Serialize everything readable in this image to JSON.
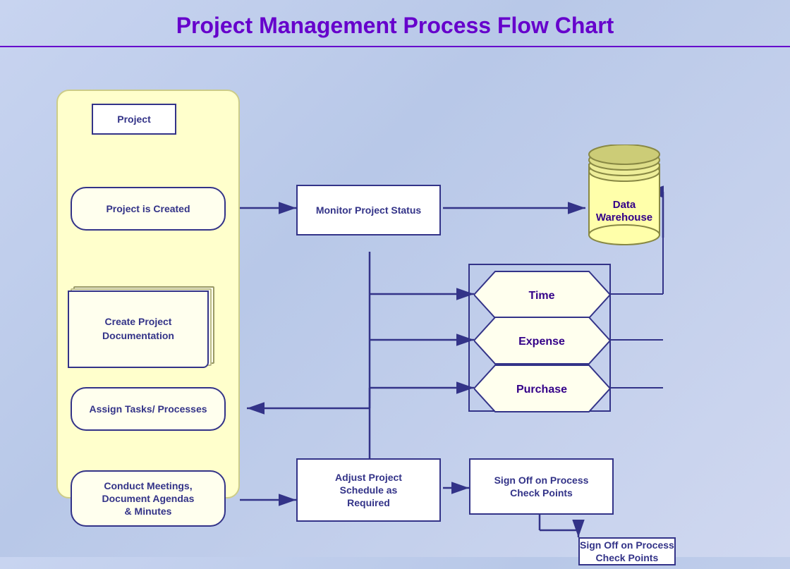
{
  "title": "Project Management Process Flow Chart",
  "nodes": {
    "laneTitleLabel": "Project",
    "projectCreated": "Project is Created",
    "createDoc": "Create Project\nDocumentation",
    "assignTasks": "Assign Tasks/\nProcesses",
    "conductMeetings": "Conduct Meetings,\nDocument Agendas\n& Minutes",
    "monitorProject": "Monitor Project\nStatus",
    "dataWarehouse": "Data\nWarehouse",
    "time": "Time",
    "expense": "Expense",
    "purchase": "Purchase",
    "adjustSchedule": "Adjust Project\nSchedule as\nRequired",
    "signOff1": "Sign Off on Process\nCheck Points",
    "signOff2": "Sign Off on Process\nCheck Points"
  }
}
